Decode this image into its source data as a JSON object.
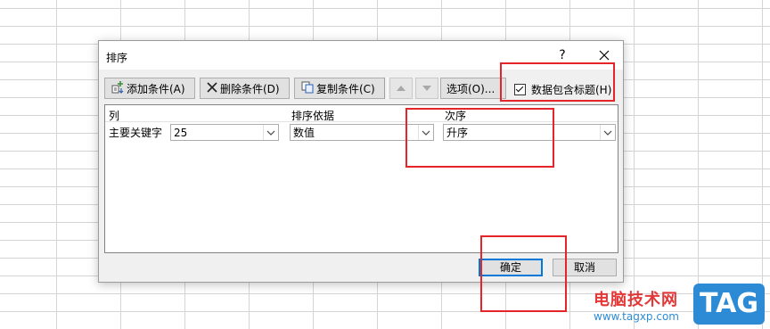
{
  "dialog": {
    "title": "排序",
    "help": "?",
    "toolbar": {
      "add_label": "添加条件(A)",
      "delete_label": "删除条件(D)",
      "copy_label": "复制条件(C)",
      "options_label": "选项(O)...",
      "has_headers_label": "数据包含标题(H)",
      "has_headers_checked": true
    },
    "columns": {
      "col": "列",
      "sort_on": "排序依据",
      "order": "次序"
    },
    "rows": [
      {
        "label": "主要关键字",
        "column": "25",
        "sort_on": "数值",
        "order": "升序"
      }
    ],
    "ok_label": "确定",
    "cancel_label": "取消"
  },
  "watermark": {
    "site_cn": "电脑技术网",
    "url": "www.tagxp.com",
    "logo": "TAG"
  },
  "colors": {
    "highlight": "#e4262b",
    "primary_border": "#0078d7",
    "logo_bg": "#2c8bd4"
  }
}
